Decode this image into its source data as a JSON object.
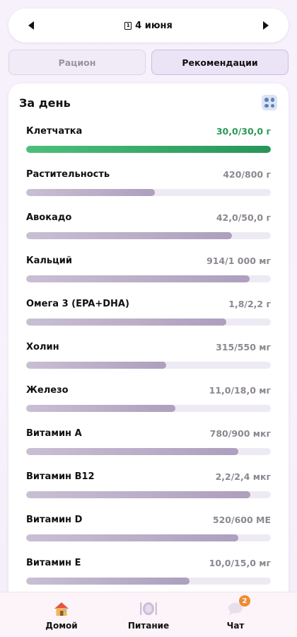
{
  "date_nav": {
    "day_number": "1",
    "date_label": "4 июня"
  },
  "tabs": [
    {
      "label": "Рацион",
      "active": false
    },
    {
      "label": "Рекомендации",
      "active": true
    }
  ],
  "card": {
    "title": "За день",
    "nutrients": [
      {
        "name": "Клетчатка",
        "value": "30,0/30,0 г",
        "progress": 1.0,
        "complete": true
      },
      {
        "name": "Растительность",
        "value": "420/800 г",
        "progress": 0.525
      },
      {
        "name": "Авокадо",
        "value": "42,0/50,0 г",
        "progress": 0.84
      },
      {
        "name": "Кальций",
        "value": "914/1 000 мг",
        "progress": 0.914
      },
      {
        "name": "Омега 3 (EPA+DHA)",
        "value": "1,8/2,2 г",
        "progress": 0.818
      },
      {
        "name": "Холин",
        "value": "315/550 мг",
        "progress": 0.573
      },
      {
        "name": "Железо",
        "value": "11,0/18,0 мг",
        "progress": 0.611
      },
      {
        "name": "Витамин A",
        "value": "780/900 мкг",
        "progress": 0.867
      },
      {
        "name": "Витамин B12",
        "value": "2,2/2,4 мкг",
        "progress": 0.917
      },
      {
        "name": "Витамин D",
        "value": "520/600 МЕ",
        "progress": 0.867
      },
      {
        "name": "Витамин E",
        "value": "10,0/15,0 мг",
        "progress": 0.667
      }
    ]
  },
  "bottom_nav": [
    {
      "label": "Домой",
      "icon": "house-icon"
    },
    {
      "label": "Питание",
      "icon": "plate-icon"
    },
    {
      "label": "Чат",
      "icon": "chat-bubble-icon",
      "badge": "2"
    }
  ],
  "colors": {
    "complete_green": "#2a9a55",
    "progress_purple": "#ad9fbd",
    "badge_orange": "#f08a2e"
  }
}
